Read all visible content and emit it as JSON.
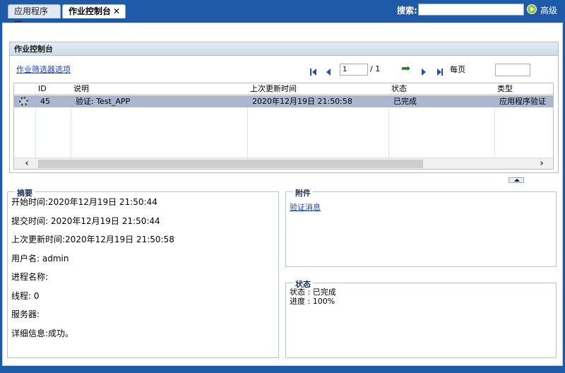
{
  "tabs": [
    {
      "label": "应用程序库"
    },
    {
      "label": "作业控制台",
      "close": "✕"
    }
  ],
  "search": {
    "label": "搜索:",
    "placeholder": "",
    "advanced_label": "高级"
  },
  "panel": {
    "title": "作业控制台",
    "filter_link": "作业筛选器选项"
  },
  "pager": {
    "current_page": "1",
    "total": "/ 1",
    "per_page_label": "每页",
    "per_page_value": ""
  },
  "table": {
    "columns": [
      "ID",
      "说明",
      "上次更新时间",
      "状态",
      "类型"
    ],
    "rows": [
      {
        "id": "45",
        "description": "验证: Test_APP",
        "updated": "2020年12月19日 21:50:58",
        "status": "已完成",
        "type": "应用程序验证"
      }
    ]
  },
  "summary": {
    "legend": "摘要",
    "start_time": "开始时间:2020年12月19日 21:50:44",
    "submit_time": "提交时间: 2020年12月19日 21:50:44",
    "last_update": "上次更新时间:2020年12月19日 21:50:58",
    "username": "用户名: admin",
    "process_name": "进程名称:",
    "thread": "线程: 0",
    "server": "服务器:",
    "details": "详细信息:成功。"
  },
  "attachments": {
    "legend": "附件",
    "link": "验证消息"
  },
  "status": {
    "legend": "状态",
    "state": "状态 : 已完成",
    "progress": "进度 : 100%"
  },
  "colors": {
    "brand": "#1e5aa8",
    "row_selected": "#a9b8cf",
    "link": "#1a3fbf"
  }
}
